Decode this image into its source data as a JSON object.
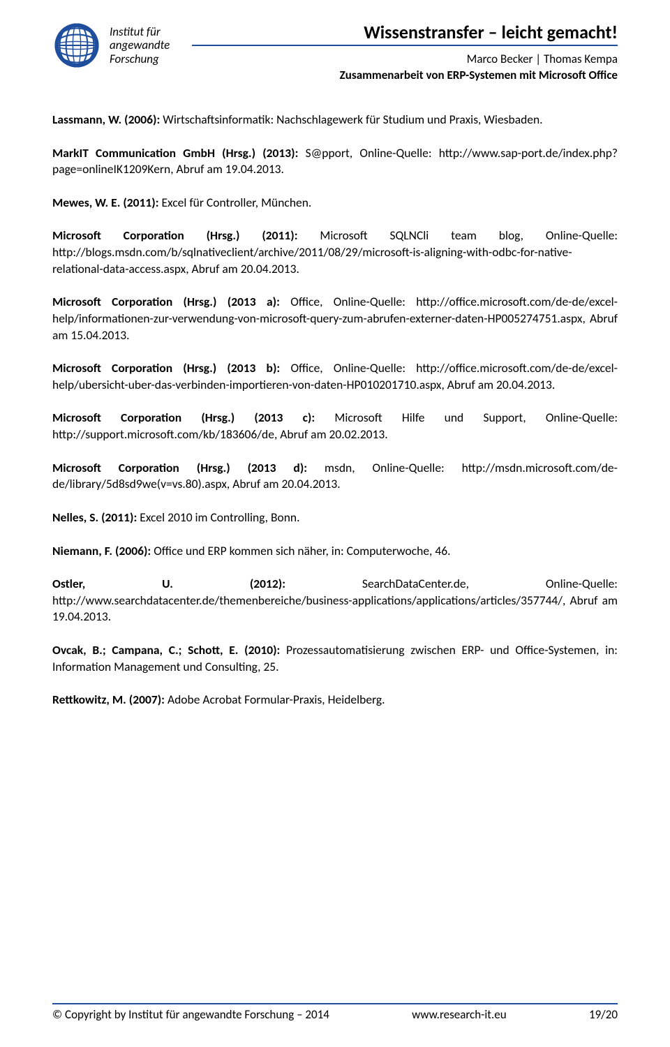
{
  "header": {
    "title": "Wissenstransfer – leicht gemacht!",
    "authors": "Marco Becker | Thomas Kempa",
    "subtitle": "Zusammenarbeit von ERP-Systemen mit Microsoft Office",
    "institute_line1": "Institut für",
    "institute_line2": "angewandte",
    "institute_line3": "Forschung"
  },
  "refs": [
    {
      "label": "Lassmann, W. (2006):",
      "rest": " Wirtschaftsinformatik: Nachschlagewerk für Studium und Praxis, Wiesbaden."
    },
    {
      "label": "MarkIT Communication GmbH (Hrsg.) (2013):",
      "rest": " S@pport, Online-Quelle: http://www.sap-port.de/index.php?page=onlineIK1209Kern, Abruf am 19.04.2013."
    },
    {
      "label": "Mewes, W. E. (2011):",
      "rest": " Excel für Controller, München."
    },
    {
      "label": "Microsoft Corporation (Hrsg.) (2011):",
      "rest": " Microsoft SQLNCli team blog, Online-Quelle: http://blogs.msdn.com/b/sqlnativeclient/archive/2011/08/29/microsoft-is-aligning-with-odbc-for-native-relational-data-access.aspx, Abruf am 20.04.2013."
    },
    {
      "label": "Microsoft Corporation (Hrsg.) (2013 a):",
      "rest": " Office, Online-Quelle: http://office.microsoft.com/de-de/excel-help/informationen-zur-verwendung-von-microsoft-query-zum-abrufen-externer-daten-HP005274751.aspx, Abruf am 15.04.2013."
    },
    {
      "label": "Microsoft Corporation (Hrsg.) (2013 b):",
      "rest": " Office, Online-Quelle: http://office.microsoft.com/de-de/excel-help/ubersicht-uber-das-verbinden-importieren-von-daten-HP010201710.aspx, Abruf am 20.04.2013."
    },
    {
      "label": "Microsoft Corporation (Hrsg.) (2013 c):",
      "rest": " Microsoft Hilfe und Support, Online-Quelle: http://support.microsoft.com/kb/183606/de, Abruf am 20.02.2013."
    },
    {
      "label": "Microsoft Corporation (Hrsg.) (2013 d):",
      "rest": " msdn, Online-Quelle: http://msdn.microsoft.com/de-de/library/5d8sd9we(v=vs.80).aspx, Abruf am 20.04.2013."
    },
    {
      "label": "Nelles, S. (2011):",
      "rest": " Excel 2010 im Controlling, Bonn."
    },
    {
      "label": "Niemann, F. (2006):",
      "rest": " Office und ERP kommen sich näher, in: Computerwoche, 46."
    },
    {
      "label": "Ostler, U. (2012):",
      "rest": " SearchDataCenter.de, Online-Quelle: http://www.searchdatacenter.de/themenbereiche/business-applications/applications/articles/357744/, Abruf am 19.04.2013.",
      "wide": true
    },
    {
      "label": "Ovcak, B.; Campana, C.; Schott, E. (2010):",
      "rest": " Prozessautomatisierung zwischen ERP- und Office-Systemen, in: Information Management und Consulting, 25."
    },
    {
      "label": "Rettkowitz, M. (2007):",
      "rest": " Adobe Acrobat Formular-Praxis, Heidelberg."
    }
  ],
  "footer": {
    "copyright": "© Copyright by Institut für angewandte Forschung – 2014",
    "url": "www.research-it.eu",
    "page": "19/20"
  }
}
